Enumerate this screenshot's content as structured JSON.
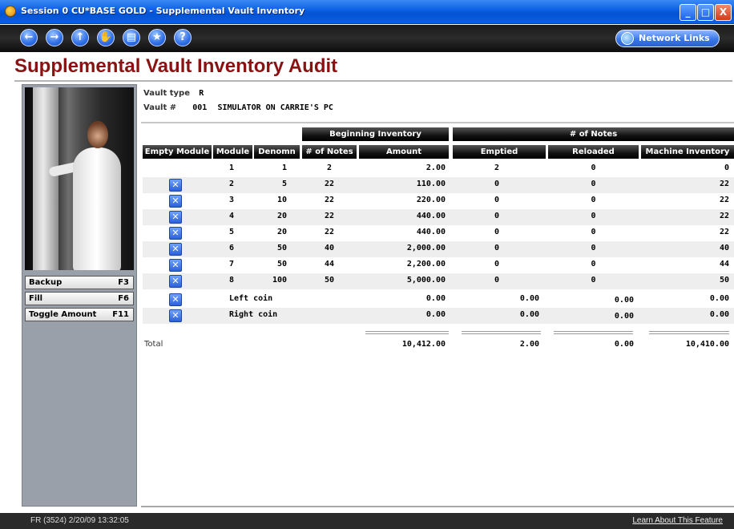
{
  "window": {
    "title": "Session 0 CU*BASE GOLD - Supplemental Vault Inventory",
    "minimize": "_",
    "maximize": "□",
    "close": "X"
  },
  "toolbar": {
    "buttons": [
      {
        "name": "back",
        "glyph": "←"
      },
      {
        "name": "forward",
        "glyph": "→"
      },
      {
        "name": "up",
        "glyph": "↑"
      },
      {
        "name": "stop",
        "glyph": "✋"
      },
      {
        "name": "print",
        "glyph": "▤"
      },
      {
        "name": "favorite",
        "glyph": "★"
      },
      {
        "name": "help",
        "glyph": "?"
      }
    ],
    "network_links": "Network Links"
  },
  "page": {
    "title": "Supplemental Vault Inventory Audit"
  },
  "function_keys": [
    {
      "label": "Backup",
      "key": "F3"
    },
    {
      "label": "Fill",
      "key": "F6"
    },
    {
      "label": "Toggle Amount",
      "key": "F11"
    }
  ],
  "header": {
    "vault_type_label": "Vault type",
    "vault_type_value": "R",
    "vault_num_label": "Vault #",
    "vault_num_value": "001",
    "vault_name": "SIMULATOR ON CARRIE'S PC"
  },
  "table": {
    "group_headers": {
      "beginning": "Beginning Inventory",
      "notes": "# of Notes"
    },
    "columns": {
      "empty_module": "Empty Module",
      "module": "Module",
      "denomn": "Denomn",
      "num_notes": "# of Notes",
      "amount": "Amount",
      "emptied": "Emptied",
      "reloaded": "Reloaded",
      "machine_inventory": "Machine Inventory"
    },
    "rows": [
      {
        "module": "1",
        "denom": "1",
        "notes": "2",
        "amount": "2.00",
        "emptied": "2",
        "reloaded": "0",
        "machine": "0"
      },
      {
        "module": "2",
        "denom": "5",
        "notes": "22",
        "amount": "110.00",
        "emptied": "0",
        "reloaded": "0",
        "machine": "22"
      },
      {
        "module": "3",
        "denom": "10",
        "notes": "22",
        "amount": "220.00",
        "emptied": "0",
        "reloaded": "0",
        "machine": "22"
      },
      {
        "module": "4",
        "denom": "20",
        "notes": "22",
        "amount": "440.00",
        "emptied": "0",
        "reloaded": "0",
        "machine": "22"
      },
      {
        "module": "5",
        "denom": "20",
        "notes": "22",
        "amount": "440.00",
        "emptied": "0",
        "reloaded": "0",
        "machine": "22"
      },
      {
        "module": "6",
        "denom": "50",
        "notes": "40",
        "amount": "2,000.00",
        "emptied": "0",
        "reloaded": "0",
        "machine": "40"
      },
      {
        "module": "7",
        "denom": "50",
        "notes": "44",
        "amount": "2,200.00",
        "emptied": "0",
        "reloaded": "0",
        "machine": "44"
      },
      {
        "module": "8",
        "denom": "100",
        "notes": "50",
        "amount": "5,000.00",
        "emptied": "0",
        "reloaded": "0",
        "machine": "50"
      }
    ],
    "coin_rows": [
      {
        "label": "Left coin",
        "amount": "0.00",
        "emptied": "0.00",
        "reloaded": "0.00",
        "machine": "0.00"
      },
      {
        "label": "Right coin",
        "amount": "0.00",
        "emptied": "0.00",
        "reloaded": "0.00",
        "machine": "0.00"
      }
    ],
    "total": {
      "label": "Total",
      "amount": "10,412.00",
      "emptied": "2.00",
      "reloaded": "0.00",
      "machine": "10,410.00"
    }
  },
  "status": {
    "left": "FR (3524) 2/20/09 13:32:05",
    "right": "Learn About This Feature"
  }
}
